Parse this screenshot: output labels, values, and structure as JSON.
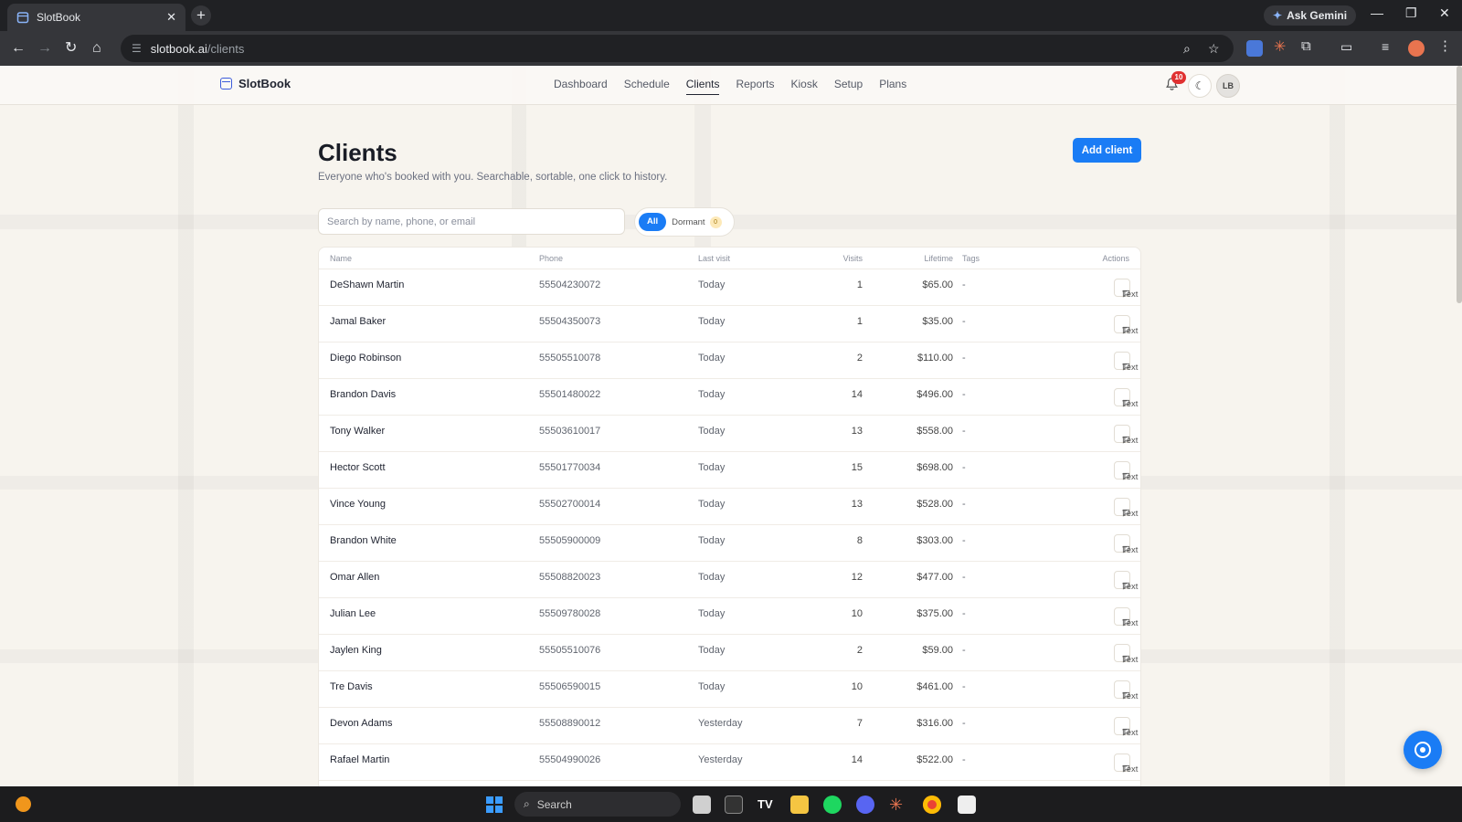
{
  "browser": {
    "tab_title": "SlotBook",
    "tab_close": "✕",
    "new_tab": "+",
    "ask_gemini": "Ask Gemini",
    "url_host": "slotbook.ai",
    "url_path": "/clients"
  },
  "app": {
    "brand": "SlotBook",
    "nav": [
      {
        "label": "Dashboard"
      },
      {
        "label": "Schedule"
      },
      {
        "label": "Clients"
      },
      {
        "label": "Reports"
      },
      {
        "label": "Kiosk"
      },
      {
        "label": "Setup"
      },
      {
        "label": "Plans"
      }
    ],
    "active_nav": "Clients",
    "notification_count": "10",
    "avatar_initials": "LB"
  },
  "page": {
    "title": "Clients",
    "subtitle": "Everyone who's booked with you. Searchable, sortable, one click to history.",
    "add_button": "Add client",
    "search_placeholder": "Search by name, phone, or email",
    "filter_all": "All",
    "filter_dormant": "Dormant",
    "dormant_count": "0"
  },
  "table": {
    "headers": {
      "name": "Name",
      "phone": "Phone",
      "last_visit": "Last visit",
      "visits": "Visits",
      "lifetime": "Lifetime",
      "tags": "Tags",
      "actions": "Actions"
    },
    "action_label": "Text",
    "rows": [
      {
        "name": "DeShawn Martin",
        "phone": "55504230072",
        "last_visit": "Today",
        "visits": "1",
        "lifetime": "$65.00",
        "tags": "-"
      },
      {
        "name": "Jamal Baker",
        "phone": "55504350073",
        "last_visit": "Today",
        "visits": "1",
        "lifetime": "$35.00",
        "tags": "-"
      },
      {
        "name": "Diego Robinson",
        "phone": "55505510078",
        "last_visit": "Today",
        "visits": "2",
        "lifetime": "$110.00",
        "tags": "-"
      },
      {
        "name": "Brandon Davis",
        "phone": "55501480022",
        "last_visit": "Today",
        "visits": "14",
        "lifetime": "$496.00",
        "tags": "-"
      },
      {
        "name": "Tony Walker",
        "phone": "55503610017",
        "last_visit": "Today",
        "visits": "13",
        "lifetime": "$558.00",
        "tags": "-"
      },
      {
        "name": "Hector Scott",
        "phone": "55501770034",
        "last_visit": "Today",
        "visits": "15",
        "lifetime": "$698.00",
        "tags": "-"
      },
      {
        "name": "Vince Young",
        "phone": "55502700014",
        "last_visit": "Today",
        "visits": "13",
        "lifetime": "$528.00",
        "tags": "-"
      },
      {
        "name": "Brandon White",
        "phone": "55505900009",
        "last_visit": "Today",
        "visits": "8",
        "lifetime": "$303.00",
        "tags": "-"
      },
      {
        "name": "Omar Allen",
        "phone": "55508820023",
        "last_visit": "Today",
        "visits": "12",
        "lifetime": "$477.00",
        "tags": "-"
      },
      {
        "name": "Julian Lee",
        "phone": "55509780028",
        "last_visit": "Today",
        "visits": "10",
        "lifetime": "$375.00",
        "tags": "-"
      },
      {
        "name": "Jaylen King",
        "phone": "55505510076",
        "last_visit": "Today",
        "visits": "2",
        "lifetime": "$59.00",
        "tags": "-"
      },
      {
        "name": "Tre Davis",
        "phone": "55506590015",
        "last_visit": "Today",
        "visits": "10",
        "lifetime": "$461.00",
        "tags": "-"
      },
      {
        "name": "Devon Adams",
        "phone": "55508890012",
        "last_visit": "Yesterday",
        "visits": "7",
        "lifetime": "$316.00",
        "tags": "-"
      },
      {
        "name": "Rafael Martin",
        "phone": "55504990026",
        "last_visit": "Yesterday",
        "visits": "14",
        "lifetime": "$522.00",
        "tags": "-"
      }
    ]
  },
  "taskbar": {
    "search_label": "Search"
  },
  "colors": {
    "accent": "#1a7cf5",
    "badge": "#e03131",
    "page_bg": "#f7f4ee"
  }
}
